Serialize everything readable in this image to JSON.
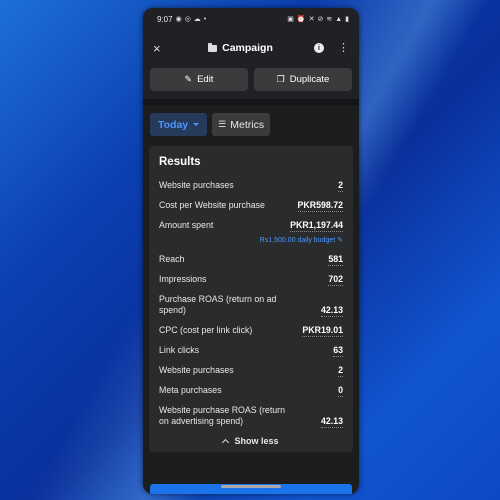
{
  "status_bar": {
    "time": "9:07",
    "left_icons": [
      "whatsapp-icon",
      "messenger-icon",
      "cloud-icon",
      "dot-icon"
    ],
    "right_icons": [
      "gallery-icon",
      "alarm-icon",
      "mute-icon",
      "dnd-icon",
      "wifi-icon",
      "signal-icon",
      "battery-icon"
    ]
  },
  "header": {
    "title": "Campaign",
    "close_icon": "×",
    "info_icon": "i",
    "more_icon": "⋮"
  },
  "actions": {
    "edit_label": "Edit",
    "duplicate_label": "Duplicate"
  },
  "filters": {
    "date_label": "Today",
    "metrics_label": "Metrics"
  },
  "results": {
    "title": "Results",
    "rows": [
      {
        "label": "Website purchases",
        "value": "2"
      },
      {
        "label": "Cost per Website purchase",
        "value": "PKR598.72"
      },
      {
        "label": "Amount spent",
        "value": "PKR1,197.44"
      },
      {
        "label": "Reach",
        "value": "581"
      },
      {
        "label": "Impressions",
        "value": "702"
      },
      {
        "label": "Purchase ROAS (return on ad spend)",
        "value": "42.13"
      },
      {
        "label": "CPC (cost per link click)",
        "value": "PKR19.01"
      },
      {
        "label": "Link clicks",
        "value": "63"
      },
      {
        "label": "Website purchases",
        "value": "2"
      },
      {
        "label": "Meta purchases",
        "value": "0"
      },
      {
        "label": "Website purchase ROAS (return on advertising spend)",
        "value": "42.13"
      }
    ],
    "budget_note": "Rs1,500.00 daily budget",
    "show_less_label": "Show less"
  },
  "colors": {
    "accent": "#4c97ff",
    "card_bg": "#2a2b2d",
    "app_bg": "#1c1d1f"
  }
}
